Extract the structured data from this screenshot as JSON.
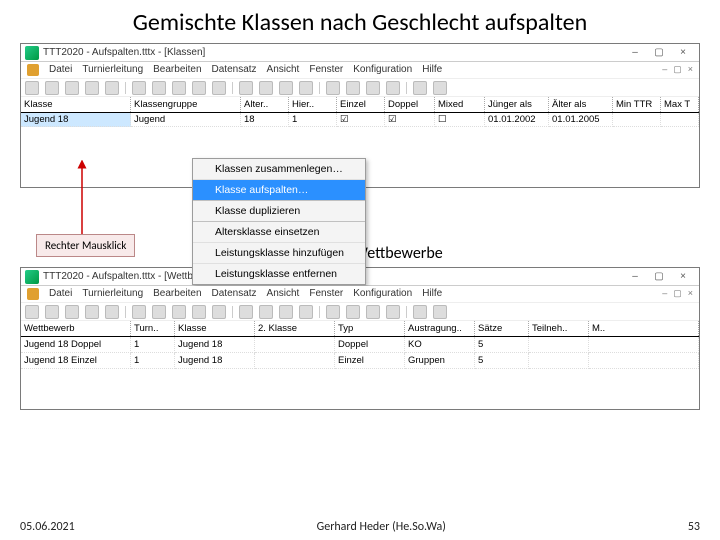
{
  "slide": {
    "title": "Gemischte Klassen nach Geschlecht aufspalten",
    "callout_rmb": "Rechter Mausklick",
    "section_label": "Zugehörige Wettbewerbe"
  },
  "win1": {
    "title": "TTT2020 - Aufspalten.tttx - [Klassen]",
    "menus": [
      "Datei",
      "Turnierleitung",
      "Bearbeiten",
      "Datensatz",
      "Ansicht",
      "Fenster",
      "Konfiguration",
      "Hilfe"
    ],
    "doc_ctrls": [
      "–",
      "▢",
      "×"
    ],
    "win_ctrls": [
      "–",
      "▢",
      "×"
    ],
    "cols": [
      "Klasse",
      "Klassengruppe",
      "Alter..",
      "Hier..",
      "Einzel",
      "Doppel",
      "Mixed",
      "Jünger als",
      "Älter als",
      "Min TTR",
      "Max T"
    ],
    "row": [
      "Jugend 18",
      "Jugend",
      "18",
      "1",
      "☑",
      "☑",
      "☐",
      "01.01.2002",
      "01.01.2005",
      "",
      ""
    ]
  },
  "ctx": {
    "items": [
      {
        "label": "Klassen zusammenlegen…",
        "hl": false
      },
      {
        "label": "Klasse aufspalten…",
        "hl": true
      },
      {
        "label": "Klasse duplizieren",
        "hl": false,
        "group": true
      },
      {
        "label": "Altersklasse einsetzen",
        "hl": false,
        "group": true
      },
      {
        "label": "Leistungsklasse hinzufügen",
        "hl": false
      },
      {
        "label": "Leistungsklasse entfernen",
        "hl": false
      }
    ]
  },
  "win2": {
    "title": "TTT2020 - Aufspalten.tttx - [Wettbewerbe]",
    "menus": [
      "Datei",
      "Turnierleitung",
      "Bearbeiten",
      "Datensatz",
      "Ansicht",
      "Fenster",
      "Konfiguration",
      "Hilfe"
    ],
    "cols": [
      "Wettbewerb",
      "Turn..",
      "Klasse",
      "2. Klasse",
      "Typ",
      "Austragung..",
      "Sätze",
      "Teilneh..",
      "M.."
    ],
    "rows": [
      [
        "Jugend 18 Doppel",
        "1",
        "Jugend 18",
        "",
        "Doppel",
        "KO",
        "5",
        "",
        ""
      ],
      [
        "Jugend 18 Einzel",
        "1",
        "Jugend 18",
        "",
        "Einzel",
        "Gruppen",
        "5",
        "",
        ""
      ]
    ]
  },
  "footer": {
    "date": "05.06.2021",
    "author": "Gerhard Heder (He.So.Wa)",
    "page": "53"
  }
}
